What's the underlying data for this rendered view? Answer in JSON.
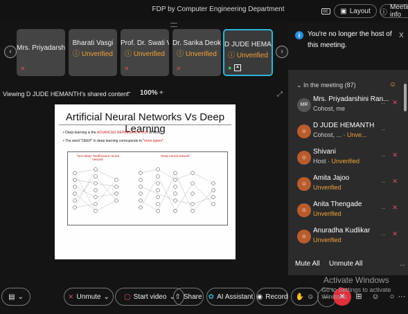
{
  "meeting_title": "FDP by Computer Engineering Department",
  "top_buttons": {
    "layout": "Layout",
    "meeting_info": "Meeting info"
  },
  "participant_tiles": [
    {
      "name": "Mrs. Priyadarshini...",
      "status": ""
    },
    {
      "name": "Bharati Vasgi",
      "status": "Unverified"
    },
    {
      "name": "Prof. Dr. Swati V. ...",
      "status": "Unverified"
    },
    {
      "name": "Dr. Sarika Deokate",
      "status": "Unverified"
    },
    {
      "name": "D JUDE HEMANTH",
      "status": "Unverified"
    }
  ],
  "share_caption": "Viewing D JUDE HEMANTH's shared content",
  "zoom": {
    "minus": "−",
    "level": "100%",
    "plus": "+"
  },
  "slide": {
    "title": "Artificial Neural Networks Vs Deep Learning",
    "bullet1_prefix": "Deep learning is the ",
    "bullet1_em": "ADVANCED REPRESENTATION",
    "bullet1_suffix": " of ANN",
    "bullet2_prefix": "The word \"DEEP\" in deep learning corresponds to \"",
    "bullet2_em": "more layers",
    "bullet2_suffix": "\".",
    "left_net_label": "\"Non-deep\" feedforward neural network",
    "right_net_label": "Deep neural network"
  },
  "toast": {
    "message": "You're no longer the host of this meeting.",
    "close": "X"
  },
  "in_meeting_label": "In the meeting (87)",
  "participants": [
    {
      "initials": "MR",
      "name": "Mrs. Priyadarshini Ran...",
      "sub": "Cohost, me",
      "unverified": ""
    },
    {
      "initials": "",
      "name": "D JUDE HEMANTH",
      "sub": "Cohost, ... · ",
      "unverified": "Unve..."
    },
    {
      "initials": "",
      "name": "Shivani",
      "sub": "Host · ",
      "unverified": "Unverified"
    },
    {
      "initials": "",
      "name": "Amita Jajoo",
      "sub": "",
      "unverified": "Unverified"
    },
    {
      "initials": "",
      "name": "Anita Thengade",
      "sub": "",
      "unverified": "Unverified"
    },
    {
      "initials": "",
      "name": "Anuradha Kudlikar",
      "sub": "",
      "unverified": "Unverified"
    }
  ],
  "panel_actions": {
    "mute_all": "Mute All",
    "unmute_all": "Unmute All",
    "more": "..."
  },
  "controls": {
    "unmute": "Unmute",
    "start_video": "Start video",
    "share": "Share",
    "ai_assistant": "AI Assistant",
    "record": "Record"
  },
  "watermark": {
    "line1": "Activate Windows",
    "line2": "Go to Settings to activate Windows."
  },
  "colors": {
    "accent": "#2fb5d8",
    "unverified": "#f2a33a",
    "muted": "#e25563",
    "end": "#e0303c"
  }
}
